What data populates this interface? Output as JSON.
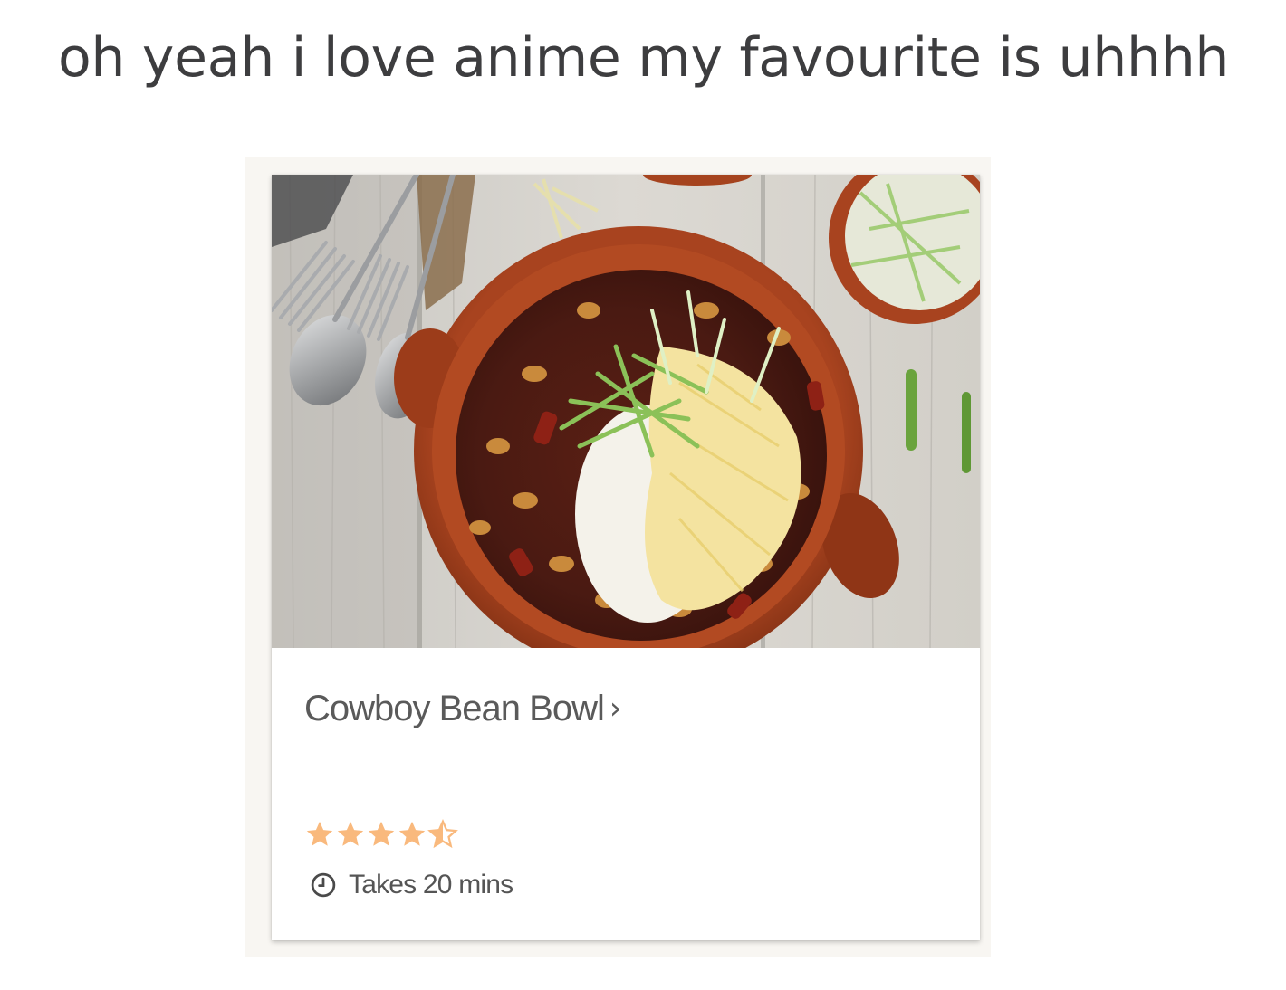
{
  "post": {
    "caption": "oh yeah i love anime my favourite is uhhhh"
  },
  "recipe_card": {
    "image_icon": "chili-bean-bowl-photo",
    "title": "Cowboy Bean Bowl",
    "chevron": "›",
    "chevron_icon": "chevron-right-icon",
    "rating": {
      "value": 4.5,
      "max": 5,
      "star_color": "#f9b97d",
      "icon": "star-icon"
    },
    "time_icon": "clock-icon",
    "time_label": "Takes 20 mins"
  }
}
